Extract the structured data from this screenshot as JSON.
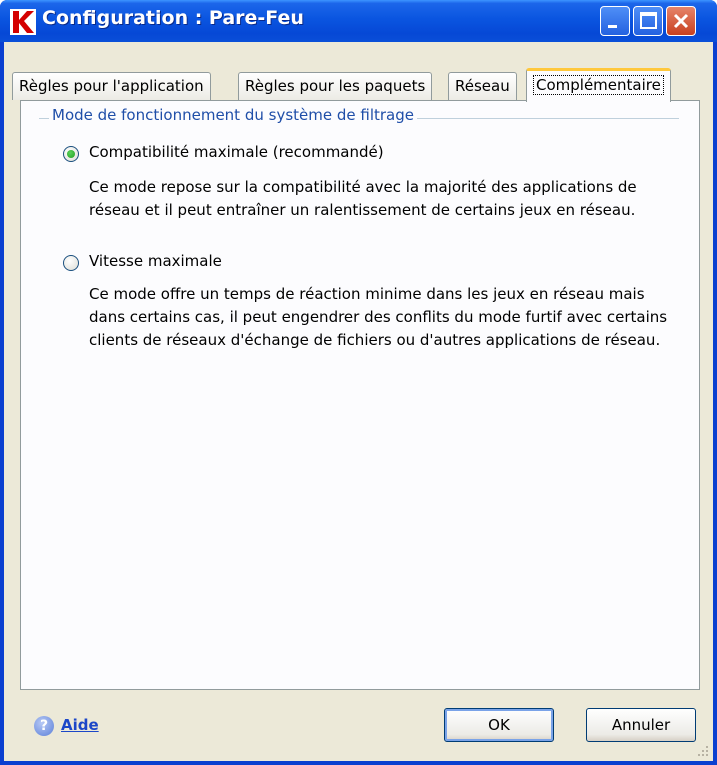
{
  "window": {
    "title": "Configuration : Pare-Feu"
  },
  "tabs": [
    {
      "label": "Règles pour l'application",
      "active": false
    },
    {
      "label": "Règles pour les paquets",
      "active": false
    },
    {
      "label": "Réseau",
      "active": false
    },
    {
      "label": "Complémentaire",
      "active": true
    }
  ],
  "group": {
    "title": "Mode de fonctionnement du système de filtrage",
    "options": [
      {
        "label": "Compatibilité maximale (recommandé)",
        "checked": true,
        "description": "Ce mode repose sur la compatibilité avec la majorité des applications de réseau et il peut entraîner un ralentissement de certains jeux en réseau."
      },
      {
        "label": "Vitesse maximale",
        "checked": false,
        "description": "Ce mode offre un temps de réaction minime dans les jeux en réseau mais dans certains cas, il peut engendrer des conflits du mode furtif avec certains clients de réseaux d'échange de fichiers ou d'autres applications de réseau."
      }
    ]
  },
  "footer": {
    "help_label": "Aide",
    "ok_label": "OK",
    "cancel_label": "Annuler"
  },
  "colors": {
    "titlebar": "#0a55e0",
    "accent_tab": "#ffc83c",
    "group_title": "#1f4ea8",
    "link": "#1c47c8"
  },
  "icons": {
    "app": "kaspersky-k-icon",
    "help": "help-question-icon"
  }
}
